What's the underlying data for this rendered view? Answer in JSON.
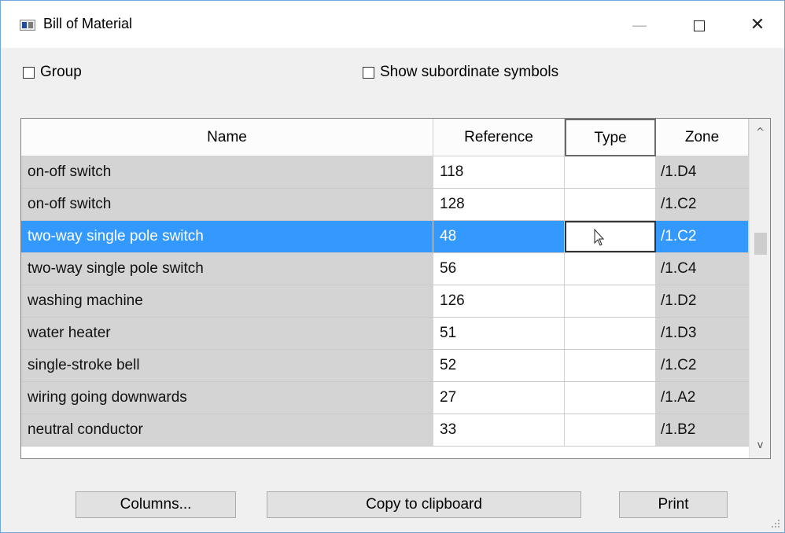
{
  "window": {
    "title": "Bill of Material",
    "app_icon": "bom-window-icon",
    "controls": {
      "minimize": "—",
      "close": "✕"
    }
  },
  "options": {
    "group_label": "Group",
    "group_checked": false,
    "subordinate_label": "Show subordinate symbols",
    "subordinate_checked": false
  },
  "table": {
    "columns": [
      "Name",
      "Reference",
      "Type",
      "Zone"
    ],
    "active_column": "Type",
    "rows": [
      {
        "name": "on-off switch",
        "reference": "118",
        "type": "",
        "zone": "/1.D4"
      },
      {
        "name": "on-off switch",
        "reference": "128",
        "type": "",
        "zone": "/1.C2"
      },
      {
        "name": "two-way single pole switch",
        "reference": "48",
        "type": "",
        "zone": "/1.C2",
        "selected": true
      },
      {
        "name": "two-way single pole switch",
        "reference": "56",
        "type": "",
        "zone": "/1.C4"
      },
      {
        "name": "washing machine",
        "reference": "126",
        "type": "",
        "zone": "/1.D2"
      },
      {
        "name": "water heater",
        "reference": "51",
        "type": "",
        "zone": "/1.D3"
      },
      {
        "name": "single-stroke bell",
        "reference": "52",
        "type": "",
        "zone": "/1.C2"
      },
      {
        "name": "wiring going downwards",
        "reference": "27",
        "type": "",
        "zone": "/1.A2"
      },
      {
        "name": "neutral conductor",
        "reference": "33",
        "type": "",
        "zone": "/1.B2"
      }
    ],
    "selected_row_index": 2,
    "colors": {
      "selection": "#3399ff",
      "readonly_cell": "#d4d4d4",
      "editable_cell": "#ffffff"
    },
    "scrollbar": {
      "up": "^",
      "down": "v"
    }
  },
  "buttons": {
    "columns_label": "Columns...",
    "copy_label": "Copy to clipboard",
    "print_label": "Print"
  }
}
